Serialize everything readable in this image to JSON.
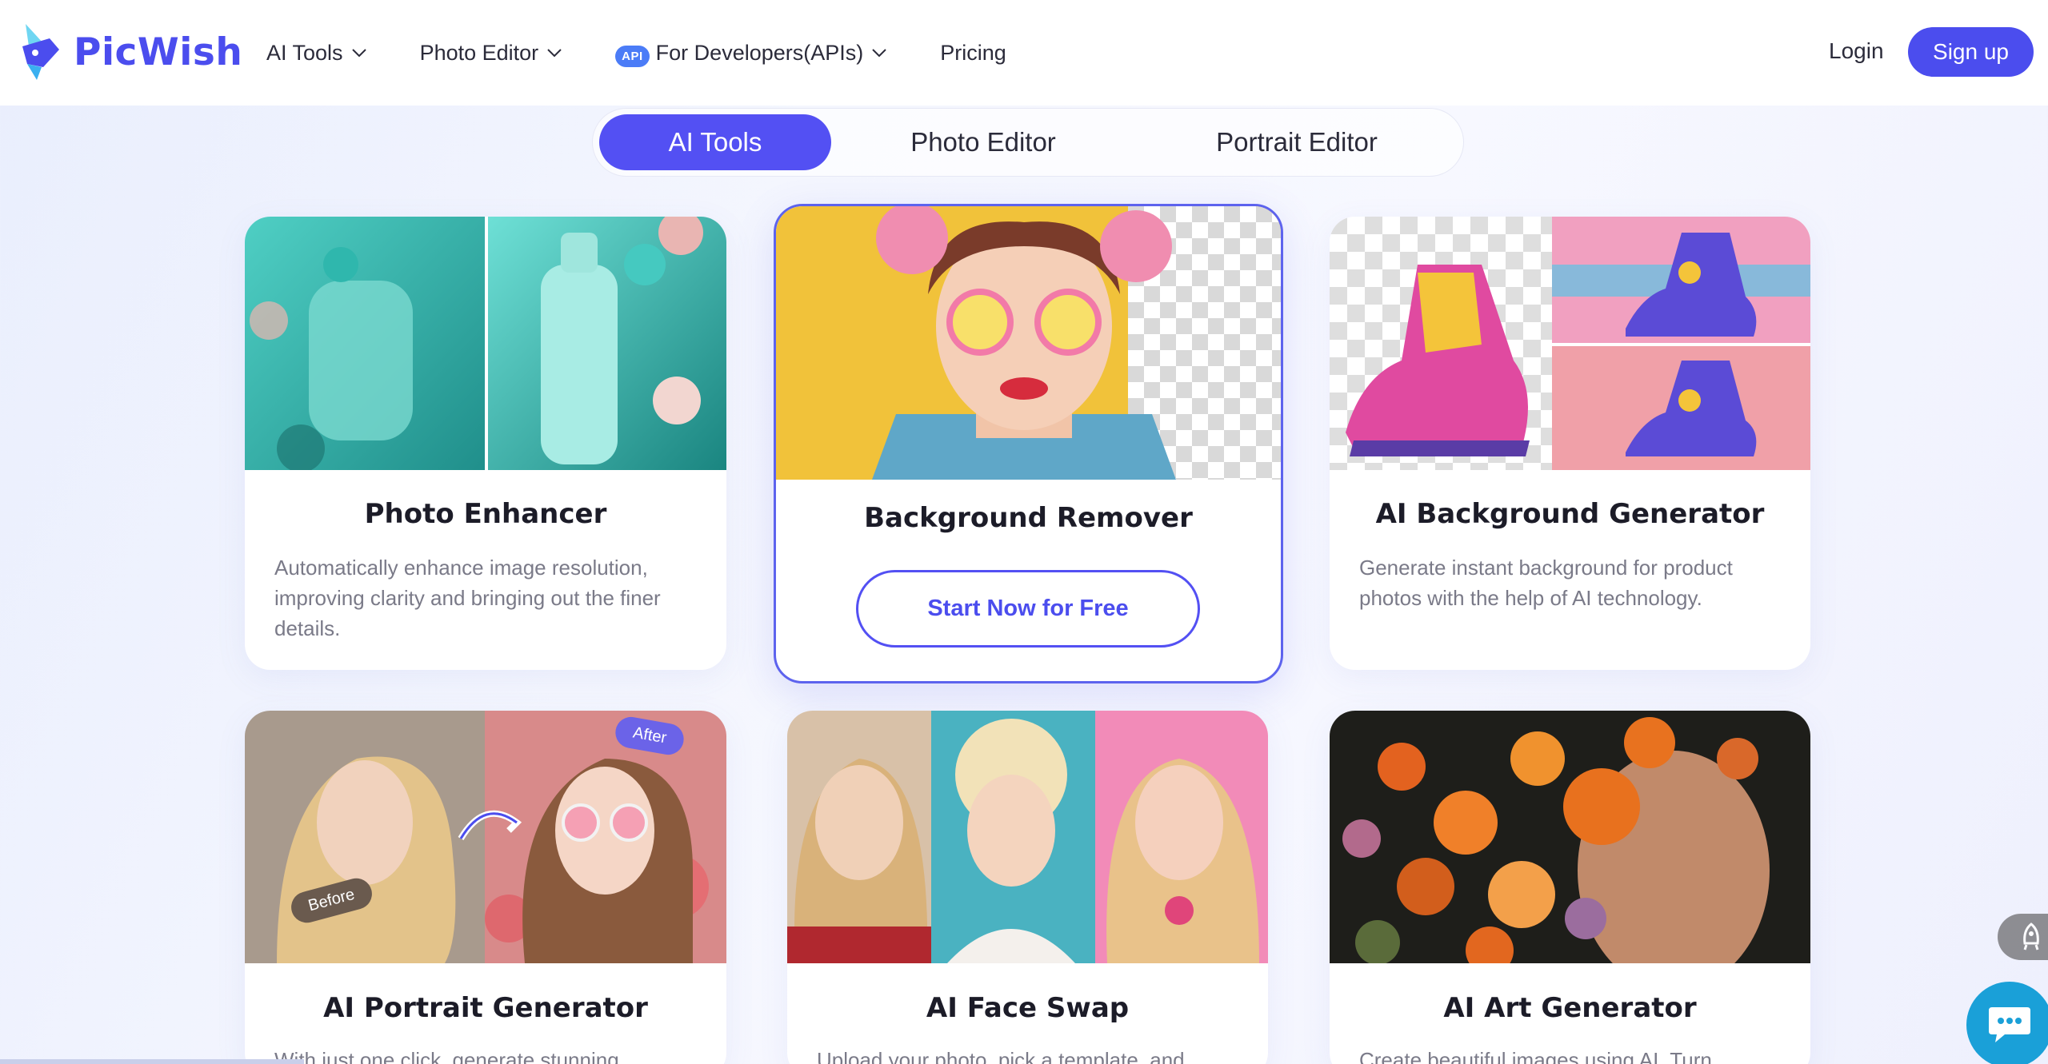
{
  "brand": {
    "name": "PicWish",
    "accent": "#4b4dee"
  },
  "nav": {
    "items": [
      {
        "label": "AI Tools",
        "dropdown": true
      },
      {
        "label": "Photo Editor",
        "dropdown": true
      },
      {
        "label": "For Developers(APIs)",
        "badge": "API",
        "dropdown": true
      },
      {
        "label": "Pricing",
        "dropdown": false
      }
    ],
    "login": "Login",
    "signup": "Sign up"
  },
  "tabs": [
    {
      "label": "AI Tools",
      "active": true
    },
    {
      "label": "Photo Editor",
      "active": false
    },
    {
      "label": "Portrait Editor",
      "active": false
    }
  ],
  "cards": [
    {
      "title": "Photo Enhancer",
      "desc": "Automatically enhance image resolution, improving clarity and bringing out the finer details."
    },
    {
      "title": "Background Remover",
      "cta": "Start Now for Free",
      "featured": true
    },
    {
      "title": "AI Background Generator",
      "desc": "Generate instant background for product photos with the help of AI technology."
    },
    {
      "title": "AI Portrait Generator",
      "desc": "With just one click, generate stunning",
      "before": "Before",
      "after": "After"
    },
    {
      "title": "AI Face Swap",
      "desc": "Upload your photo, pick a template, and"
    },
    {
      "title": "AI Art Generator",
      "desc": "Create beautiful images using AI. Turn"
    }
  ],
  "icons": {
    "chevron": "chevron-down-icon",
    "chat": "chat-icon",
    "rocket": "rocket-icon",
    "logo": "picwish-logo-icon"
  }
}
